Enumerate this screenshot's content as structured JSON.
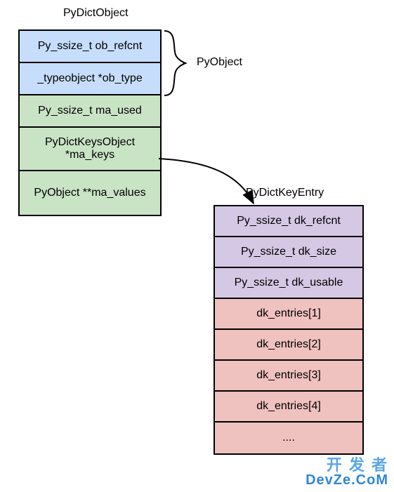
{
  "titles": {
    "left": "PyDictObject",
    "brace_label": "PyObject",
    "right": "PyDictKeyEntry"
  },
  "left_struct": {
    "rows": [
      {
        "label": "Py_ssize_t ob_refcnt",
        "color": "blue"
      },
      {
        "label": "_typeobject *ob_type",
        "color": "blue"
      },
      {
        "label": "Py_ssize_t ma_used",
        "color": "green"
      },
      {
        "label": "PyDictKeysObject *ma_keys",
        "color": "green"
      },
      {
        "label": "PyObject **ma_values",
        "color": "green"
      }
    ]
  },
  "right_struct": {
    "rows": [
      {
        "label": "Py_ssize_t dk_refcnt",
        "color": "purple"
      },
      {
        "label": "Py_ssize_t dk_size",
        "color": "purple"
      },
      {
        "label": "Py_ssize_t dk_usable",
        "color": "purple"
      },
      {
        "label": "dk_entries[1]",
        "color": "pink"
      },
      {
        "label": "dk_entries[2]",
        "color": "pink"
      },
      {
        "label": "dk_entries[3]",
        "color": "pink"
      },
      {
        "label": "dk_entries[4]",
        "color": "pink"
      },
      {
        "label": "....",
        "color": "pink"
      }
    ]
  },
  "watermark": {
    "line1": "开 发 者",
    "line2": "DevZe.CoM"
  }
}
